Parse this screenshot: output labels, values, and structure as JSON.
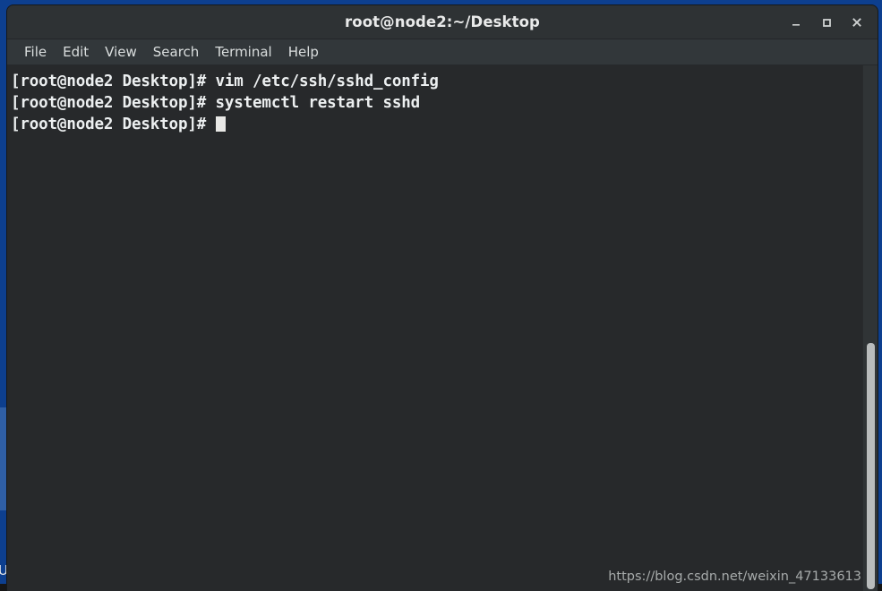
{
  "desktop": {
    "background_color": "#0d3f8f",
    "selected_icon_highlight_color": "#2f5fa6",
    "icon_label_partial": "Ur"
  },
  "window": {
    "title": "root@node2:~/Desktop",
    "controls": {
      "minimize": "minimize-icon",
      "maximize": "maximize-icon",
      "close": "close-icon"
    },
    "titlebar_color": "#2e3234",
    "body_color": "#27292b"
  },
  "menubar": {
    "items": [
      {
        "label": "File"
      },
      {
        "label": "Edit"
      },
      {
        "label": "View"
      },
      {
        "label": "Search"
      },
      {
        "label": "Terminal"
      },
      {
        "label": "Help"
      }
    ]
  },
  "terminal": {
    "prompt": "[root@node2 Desktop]# ",
    "lines": [
      {
        "prompt": "[root@node2 Desktop]# ",
        "command": "vim /etc/ssh/sshd_config"
      },
      {
        "prompt": "[root@node2 Desktop]# ",
        "command": "systemctl restart sshd"
      },
      {
        "prompt": "[root@node2 Desktop]# ",
        "command": ""
      }
    ],
    "text_color": "#eceff0",
    "cursor_color": "#e8e8e6"
  },
  "scrollbar": {
    "orientation": "vertical",
    "thumb_color": "#b9bcbc"
  },
  "watermark": {
    "text": "https://blog.csdn.net/weixin_47133613"
  }
}
